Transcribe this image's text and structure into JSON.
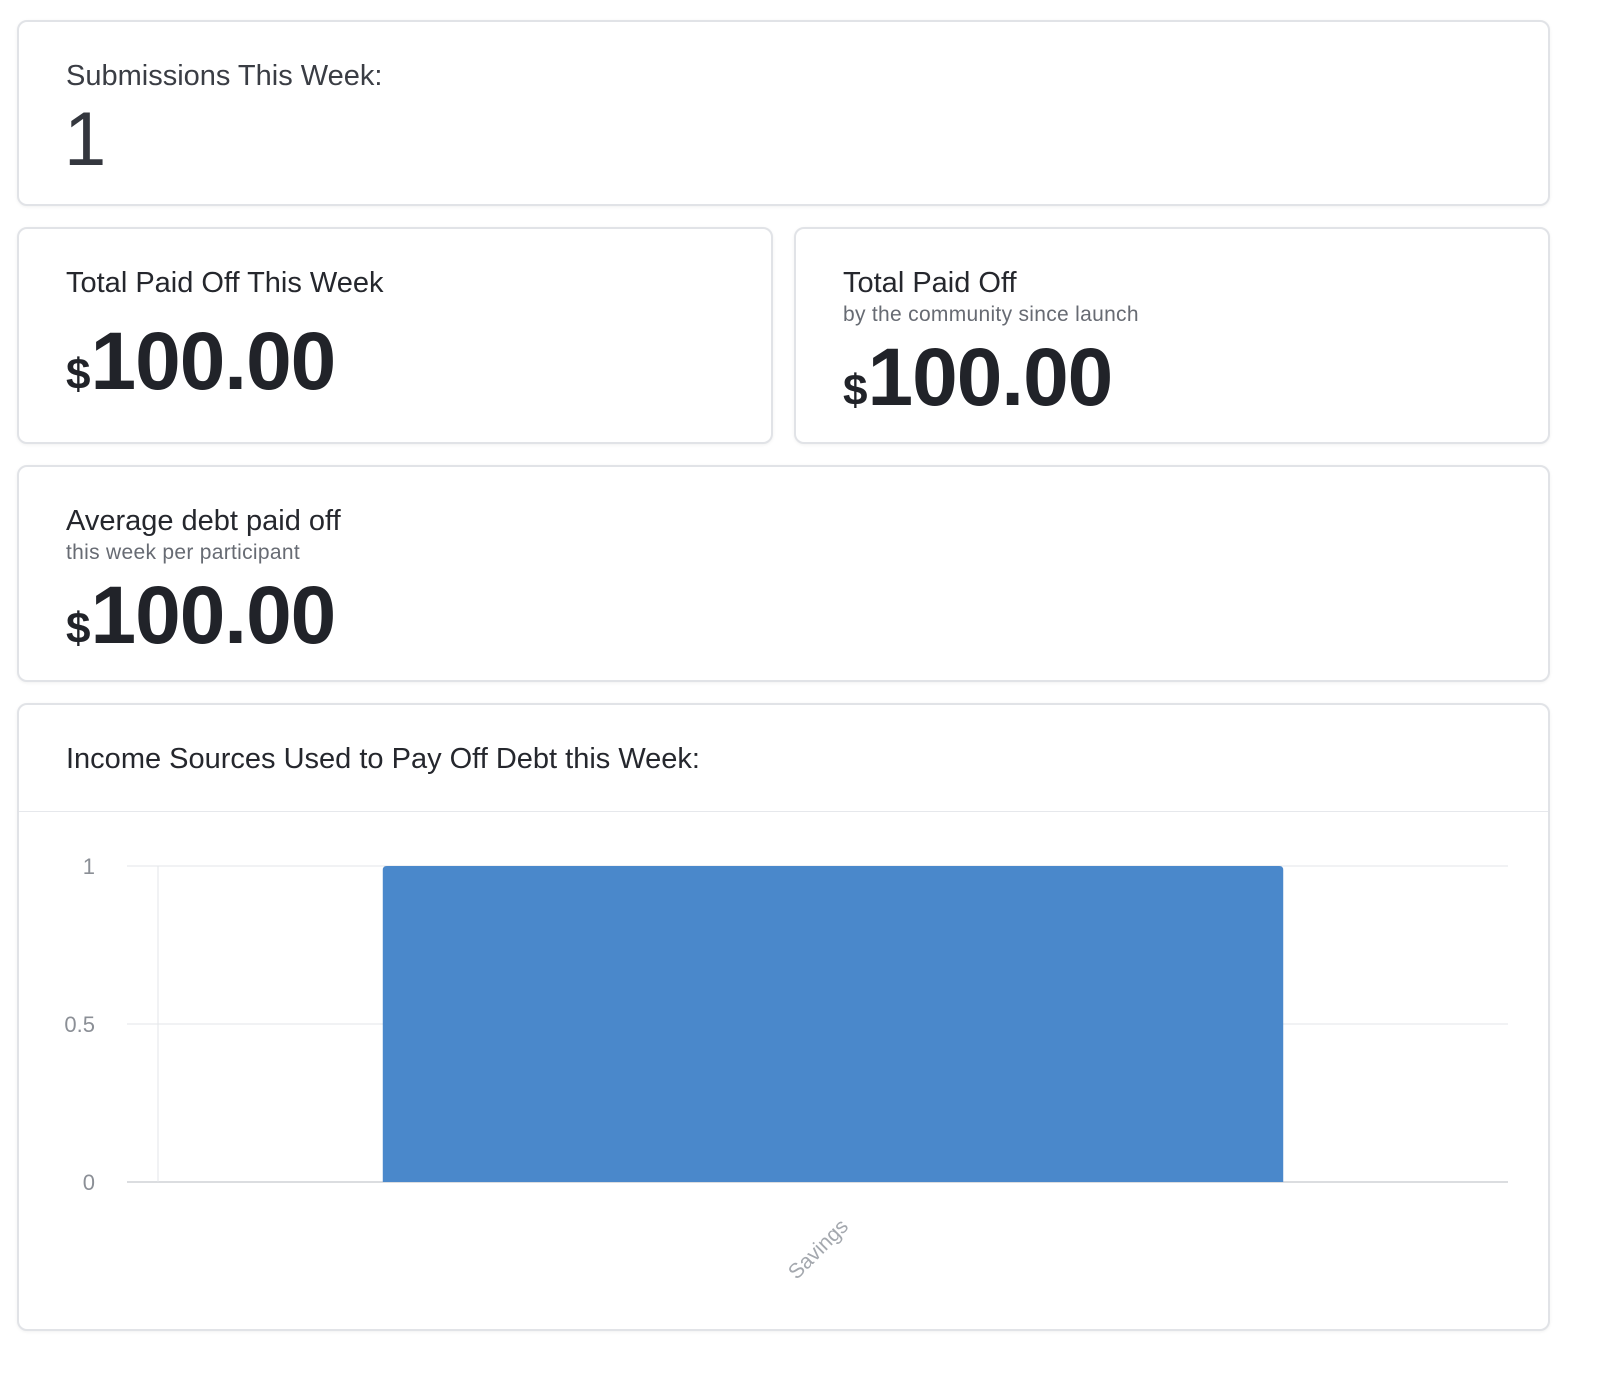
{
  "submissions": {
    "label": "Submissions This Week:",
    "value": "1"
  },
  "week_total": {
    "label": "Total Paid Off This Week",
    "currency": "$",
    "amount": "100.00"
  },
  "all_time_total": {
    "label": "Total Paid Off",
    "sublabel": "by the community since launch",
    "currency": "$",
    "amount": "100.00"
  },
  "average": {
    "label": "Average debt paid off",
    "sublabel": "this week per participant",
    "currency": "$",
    "amount": "100.00"
  },
  "income_chart": {
    "title": "Income Sources Used to Pay Off Debt this Week:"
  },
  "chart_data": {
    "type": "bar",
    "title": "Income Sources Used to Pay Off Debt this Week:",
    "categories": [
      "Savings"
    ],
    "values": [
      1
    ],
    "ylim": [
      0,
      1
    ],
    "yticks": [
      "0",
      "0.5",
      "1"
    ],
    "xlabel": "",
    "ylabel": "",
    "grid": true,
    "bar_color": "#4a88cb"
  }
}
